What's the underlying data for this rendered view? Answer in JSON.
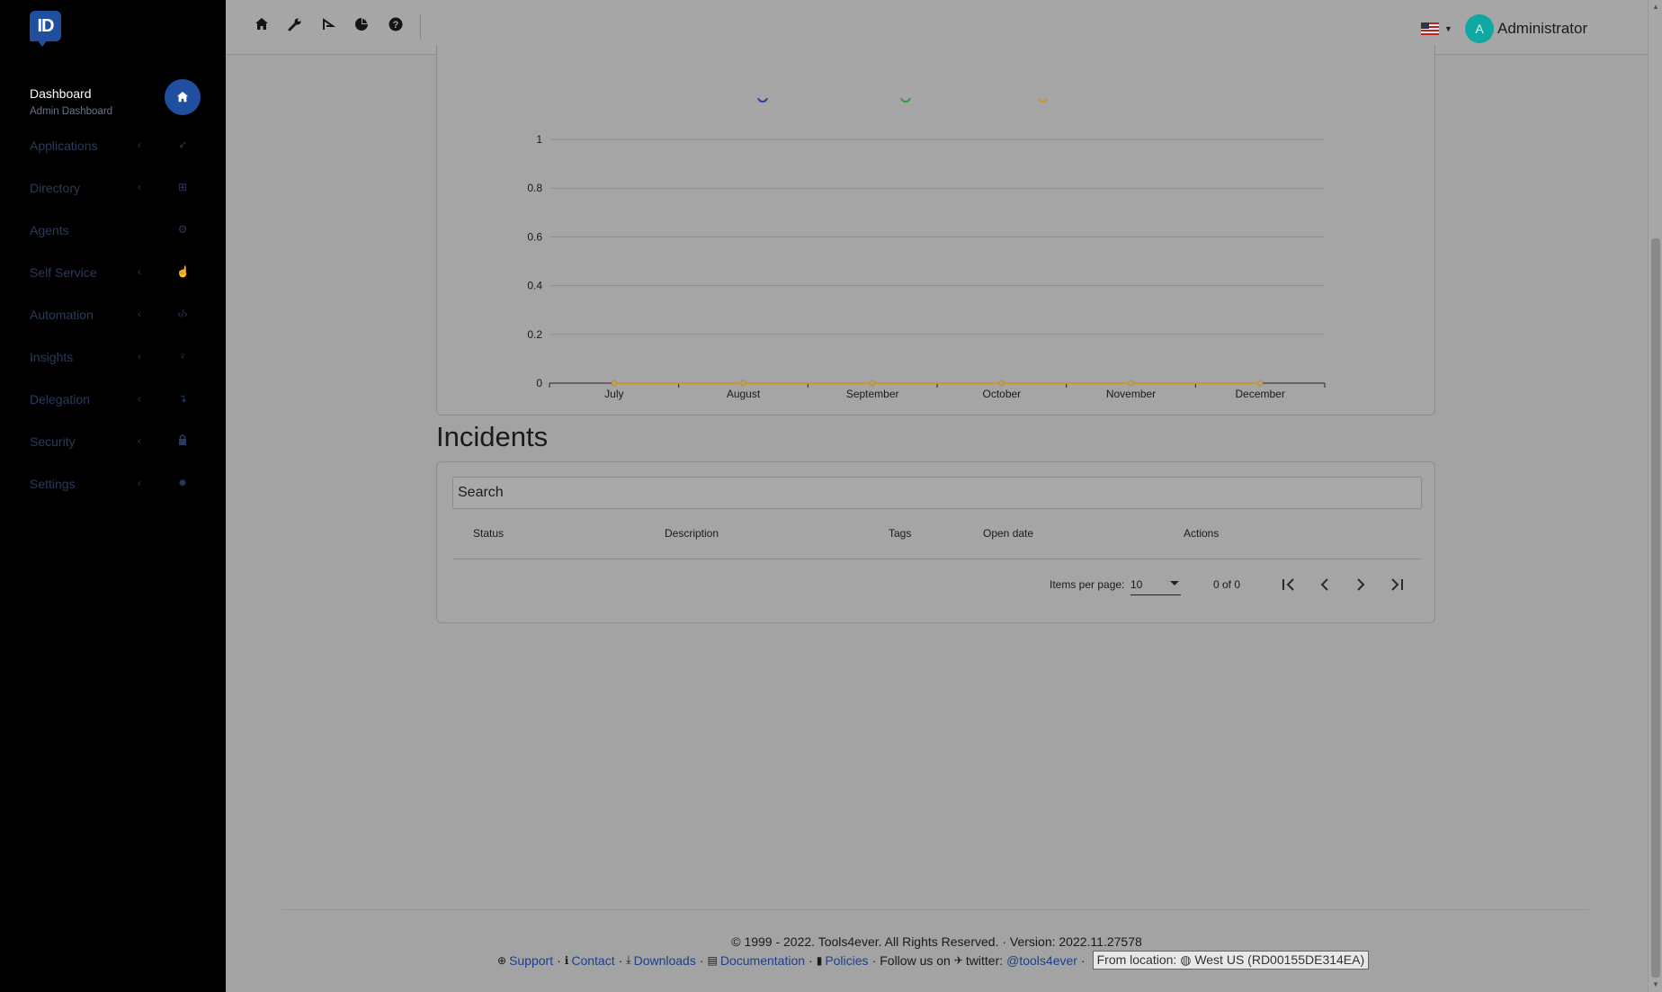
{
  "logo": {
    "text": "ID"
  },
  "sidebar": {
    "dashboard": {
      "label": "Dashboard",
      "sub": "Admin Dashboard"
    },
    "items": [
      {
        "label": "Applications",
        "icon": "rocket-icon",
        "chevron": true
      },
      {
        "label": "Directory",
        "icon": "sitemap-icon",
        "chevron": true
      },
      {
        "label": "Agents",
        "icon": "users-cog-icon",
        "chevron": false
      },
      {
        "label": "Self Service",
        "icon": "hand-pointer-icon",
        "chevron": true
      },
      {
        "label": "Automation",
        "icon": "code-icon",
        "chevron": true
      },
      {
        "label": "Insights",
        "icon": "lightbulb-icon",
        "chevron": true
      },
      {
        "label": "Delegation",
        "icon": "level-down-icon",
        "chevron": true
      },
      {
        "label": "Security",
        "icon": "lock-icon",
        "chevron": true
      },
      {
        "label": "Settings",
        "icon": "gear-icon",
        "chevron": true
      }
    ]
  },
  "topbar": {
    "icons": [
      "home-icon",
      "wrench-icon",
      "sign-icon",
      "pie-chart-icon",
      "help-icon"
    ],
    "avatar_letter": "A",
    "username": "Administrator",
    "alert": "!"
  },
  "chart_data": {
    "type": "line",
    "categories": [
      "July",
      "August",
      "September",
      "October",
      "November",
      "December"
    ],
    "y_ticks": [
      "0",
      "0.2",
      "0.4",
      "0.6",
      "0.8",
      "1"
    ],
    "ylim": [
      0,
      1
    ],
    "series": [
      {
        "values": [
          0,
          0,
          0,
          0,
          0,
          0
        ],
        "color": "#1f3fa0"
      },
      {
        "values": [
          0,
          0,
          0,
          0,
          0,
          0
        ],
        "color": "#2e9a3a"
      },
      {
        "values": [
          0,
          0,
          0,
          0,
          0,
          0
        ],
        "color": "#c8962a"
      }
    ],
    "grid": true,
    "legend": "top-center"
  },
  "incidents": {
    "title": "Incidents",
    "search_placeholder": "Search",
    "columns": [
      "Status",
      "Description",
      "Tags",
      "Open date",
      "Actions"
    ],
    "rows": [],
    "items_per_page_label": "Items per page:",
    "items_per_page": "10",
    "range": "0 of 0"
  },
  "footer": {
    "copyright": "© 1999 - 2022. Tools4ever. All Rights Reserved. · Version: 2022.11.27578",
    "support": "Support",
    "contact": "Contact",
    "downloads": "Downloads",
    "documentation": "Documentation",
    "policies": "Policies",
    "follow": "Follow us on",
    "twitter_label": "twitter:",
    "twitter_handle": "@tools4ever",
    "location_label": "From location:",
    "location_value": "West US (RD00155DE314EA)"
  }
}
